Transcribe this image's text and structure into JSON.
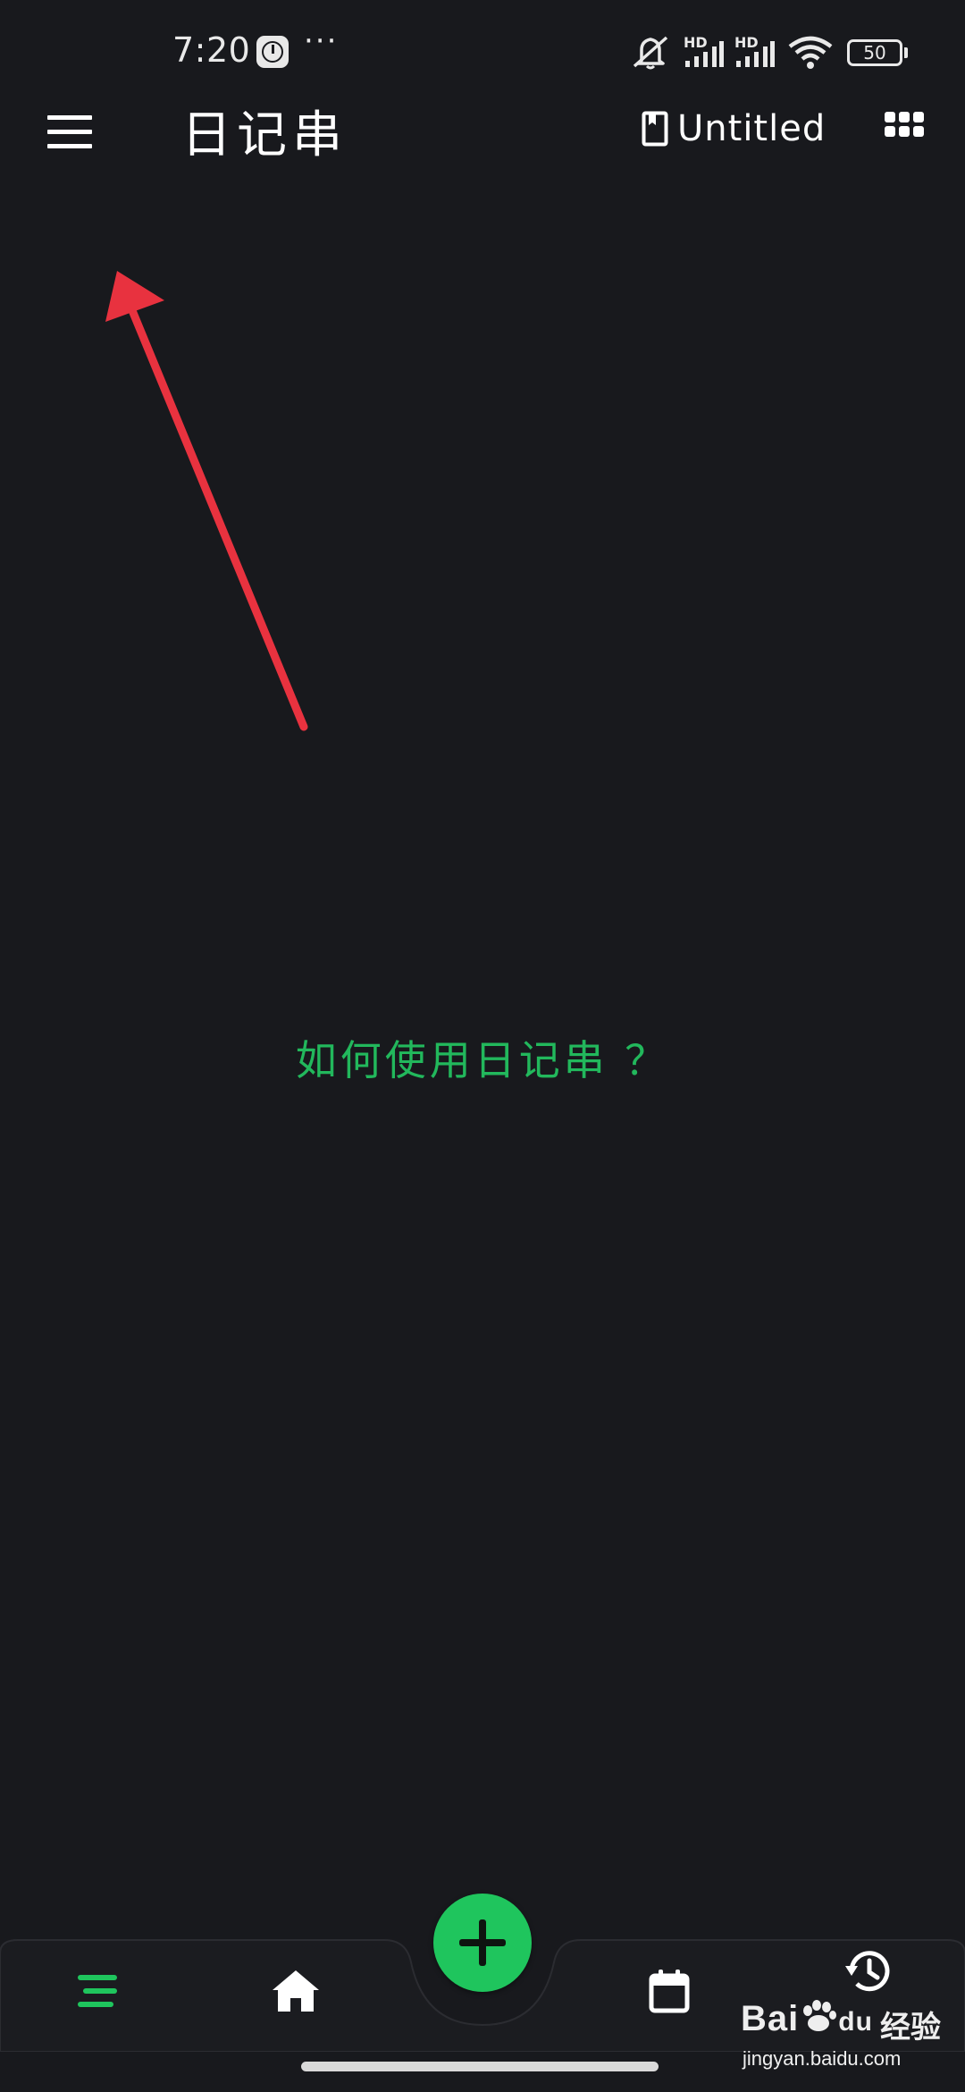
{
  "status_bar": {
    "time": "7:20",
    "more_indicator": "···",
    "network_1": "HD",
    "network_2": "HD",
    "battery": "50"
  },
  "app_bar": {
    "title": "日记串",
    "notebook_name": "Untitled",
    "menu_icon": "hamburger-menu-icon",
    "notebook_icon": "notebook-icon",
    "grid_icon": "apps-grid-icon"
  },
  "main": {
    "help_link": "如何使用日记串 ？"
  },
  "bottom_nav": {
    "items": [
      {
        "icon": "list-icon",
        "active": true
      },
      {
        "icon": "home-icon",
        "active": false
      },
      {
        "icon": "add-icon",
        "active": false
      },
      {
        "icon": "calendar-icon",
        "active": false
      },
      {
        "icon": "history-icon",
        "active": false
      }
    ]
  },
  "watermark": {
    "brand": "Bai",
    "brand_suffix": "du",
    "label": "经验",
    "url": "jingyan.baidu.com"
  },
  "colors": {
    "background": "#18191d",
    "accent": "#1fc55d",
    "annotation_arrow": "#e8323f",
    "text": "#ffffff"
  }
}
